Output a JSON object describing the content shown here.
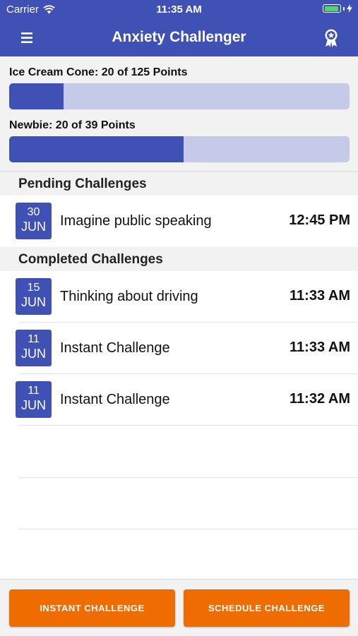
{
  "status_bar": {
    "carrier": "Carrier",
    "time": "11:35 AM",
    "battery_color": "#4cd964"
  },
  "nav": {
    "title": "Anxiety Challenger",
    "menu_icon": "hamburger-menu-icon",
    "award_icon": "award-ribbon-icon"
  },
  "progress": [
    {
      "label": "Ice Cream Cone: 20 of 125 Points",
      "fraction": 0.16
    },
    {
      "label": "Newbie: 20 of 39 Points",
      "fraction": 0.513
    }
  ],
  "pending": {
    "header": "Pending Challenges",
    "items": [
      {
        "day": "30",
        "month": "JUN",
        "name": "Imagine public speaking",
        "time": "12:45 PM"
      }
    ]
  },
  "completed": {
    "header": "Completed Challenges",
    "items": [
      {
        "day": "15",
        "month": "JUN",
        "name": "Thinking about driving",
        "time": "11:33 AM"
      },
      {
        "day": "11",
        "month": "JUN",
        "name": "Instant Challenge",
        "time": "11:33 AM"
      },
      {
        "day": "11",
        "month": "JUN",
        "name": "Instant Challenge",
        "time": "11:32 AM"
      }
    ]
  },
  "buttons": {
    "instant": "INSTANT CHALLENGE",
    "schedule": "SCHEDULE CHALLENGE"
  },
  "colors": {
    "primary": "#3f51b5",
    "primary_light": "#c5cae9",
    "accent": "#ef6c00"
  }
}
